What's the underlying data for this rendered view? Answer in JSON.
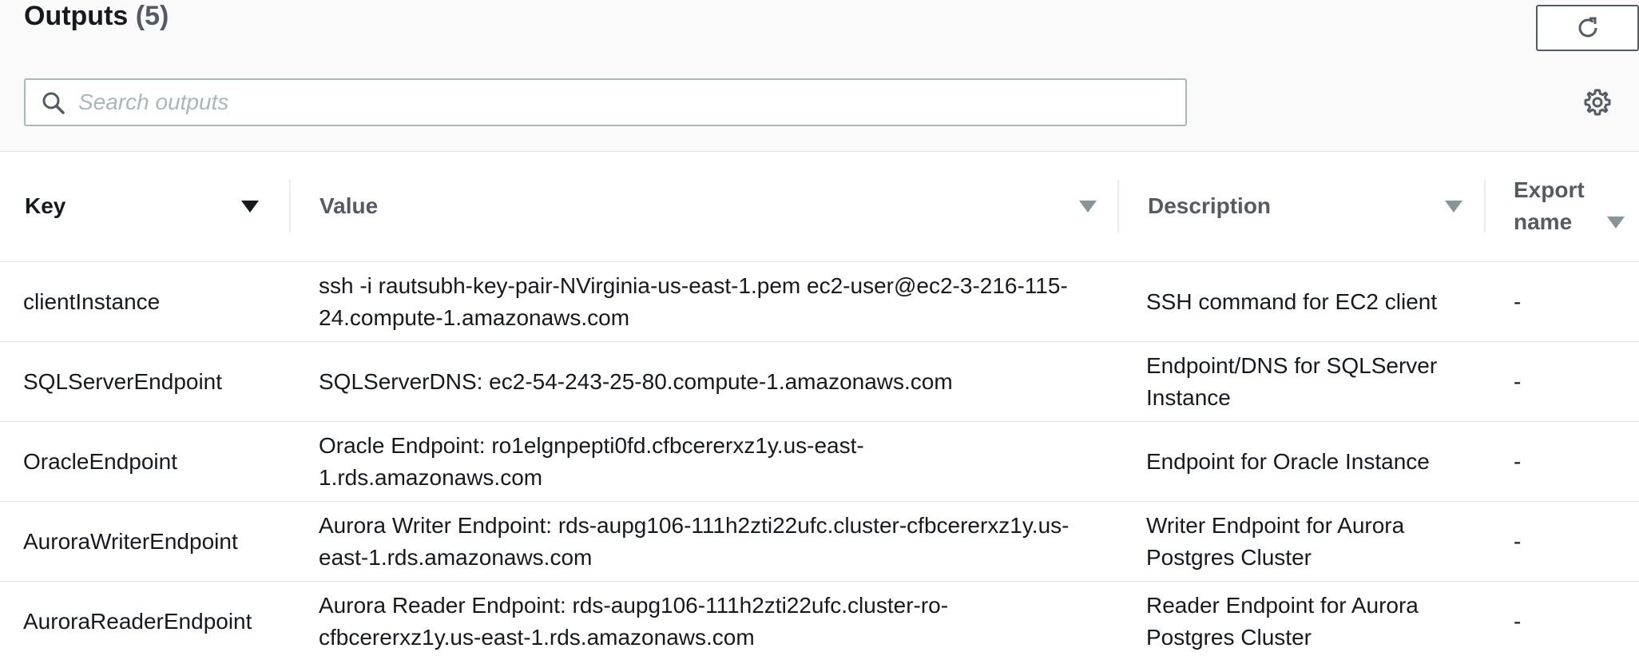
{
  "header": {
    "title": "Outputs",
    "count": "(5)"
  },
  "search": {
    "placeholder": "Search outputs",
    "value": ""
  },
  "icons": {
    "refresh": "refresh-icon",
    "search": "search-icon",
    "settings": "gear-icon",
    "sort": "caret-down-icon"
  },
  "table": {
    "columns": [
      {
        "label": "Key"
      },
      {
        "label": "Value"
      },
      {
        "label": "Description"
      },
      {
        "label": "Export name"
      }
    ],
    "rows": [
      {
        "key": "clientInstance",
        "value": "ssh -i rautsubh-key-pair-NVirginia-us-east-1.pem ec2-user@ec2-3-216-115-24.compute-1.amazonaws.com",
        "description": "SSH command for EC2 client",
        "export_name": "-"
      },
      {
        "key": "SQLServerEndpoint",
        "value": "SQLServerDNS: ec2-54-243-25-80.compute-1.amazonaws.com",
        "description": "Endpoint/DNS for SQLServer Instance",
        "export_name": "-"
      },
      {
        "key": "OracleEndpoint",
        "value": "Oracle Endpoint: ro1elgnpepti0fd.cfbcererxz1y.us-east-1.rds.amazonaws.com",
        "description": "Endpoint for Oracle Instance",
        "export_name": "-"
      },
      {
        "key": "AuroraWriterEndpoint",
        "value": "Aurora Writer Endpoint: rds-aupg106-111h2zti22ufc.cluster-cfbcererxz1y.us-east-1.rds.amazonaws.com",
        "description": "Writer Endpoint for Aurora Postgres Cluster",
        "export_name": "-"
      },
      {
        "key": "AuroraReaderEndpoint",
        "value": "Aurora Reader Endpoint: rds-aupg106-111h2zti22ufc.cluster-ro-cfbcererxz1y.us-east-1.rds.amazonaws.com",
        "description": "Reader Endpoint for Aurora Postgres Cluster",
        "export_name": "-"
      }
    ]
  },
  "colors": {
    "text": "#16191f",
    "muted": "#545b64",
    "border": "#aab7b8",
    "header_bg": "#fafafa"
  }
}
